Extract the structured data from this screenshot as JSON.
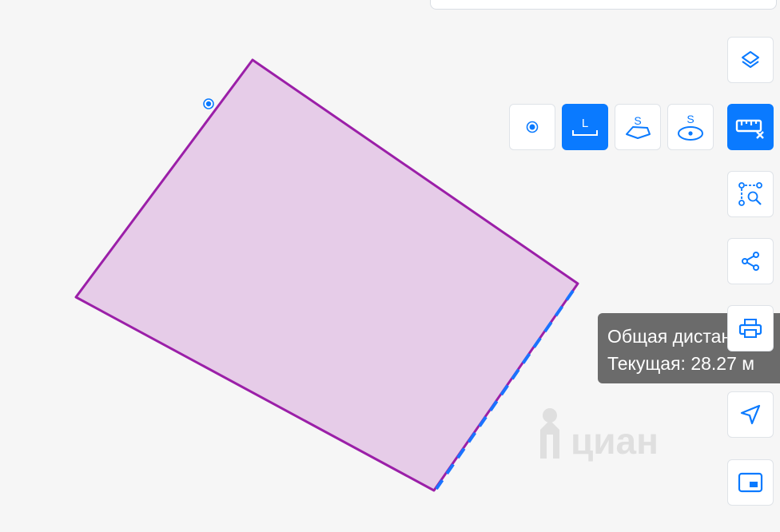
{
  "map": {
    "polygon_fill": "#e6cce8",
    "polygon_stroke": "#9b1fa8",
    "measure_line_color": "#1a73ff",
    "point_marker_color": "#0a7aff"
  },
  "measure_tools": {
    "point": {
      "icon": "point-icon",
      "active": false
    },
    "distance": {
      "icon": "distance-icon",
      "label": "L",
      "active": true
    },
    "area": {
      "icon": "area-icon",
      "label": "S",
      "active": false
    },
    "radius_area": {
      "icon": "circle-area-icon",
      "label": "S",
      "active": false
    }
  },
  "side_toolbar": {
    "layers": {
      "icon": "layers-icon"
    },
    "ruler": {
      "icon": "ruler-close-icon",
      "active": true
    },
    "select_area": {
      "icon": "select-area-search-icon"
    },
    "share": {
      "icon": "share-icon"
    },
    "print": {
      "icon": "printer-icon"
    },
    "locate": {
      "icon": "navigation-arrow-icon"
    },
    "minimap": {
      "icon": "picture-in-picture-icon"
    }
  },
  "tooltip": {
    "total_label": "Общая дистанция: ",
    "current_label": "Текущая: 28.27 м"
  },
  "watermark": {
    "text": "циан"
  },
  "colors": {
    "accent": "#0a7aff",
    "tooltip_bg": "#6b6b6b",
    "background": "#f6f6f6"
  }
}
